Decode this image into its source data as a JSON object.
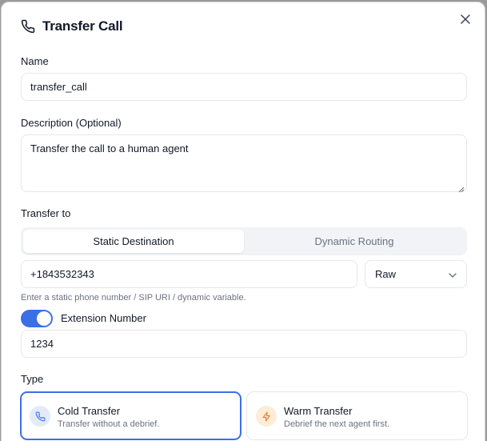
{
  "dialog": {
    "title": "Transfer Call",
    "icon": "phone-icon",
    "close_icon": "close-icon"
  },
  "name": {
    "label": "Name",
    "value": "transfer_call"
  },
  "description": {
    "label": "Description (Optional)",
    "value": "Transfer the call to a human agent"
  },
  "transfer_to": {
    "label": "Transfer to",
    "tabs": [
      {
        "label": "Static Destination",
        "active": true
      },
      {
        "label": "Dynamic Routing",
        "active": false
      }
    ],
    "destination_value": "+1843532343",
    "format_select": {
      "value": "Raw"
    },
    "helper_text": "Enter a static phone number / SIP URI / dynamic variable."
  },
  "extension": {
    "label": "Extension Number",
    "enabled": true,
    "value": "1234"
  },
  "type": {
    "label": "Type",
    "options": [
      {
        "title": "Cold Transfer",
        "subtitle": "Transfer without a debrief.",
        "icon": "phone-icon",
        "selected": true
      },
      {
        "title": "Warm Transfer",
        "subtitle": "Debrief the next agent first.",
        "icon": "lightning-icon",
        "selected": false
      }
    ]
  },
  "colors": {
    "accent": "#3b6fe8",
    "warm_icon_bg": "#fdecd8",
    "warm_icon": "#e8792f",
    "cold_icon_bg": "#e3ebfb"
  }
}
